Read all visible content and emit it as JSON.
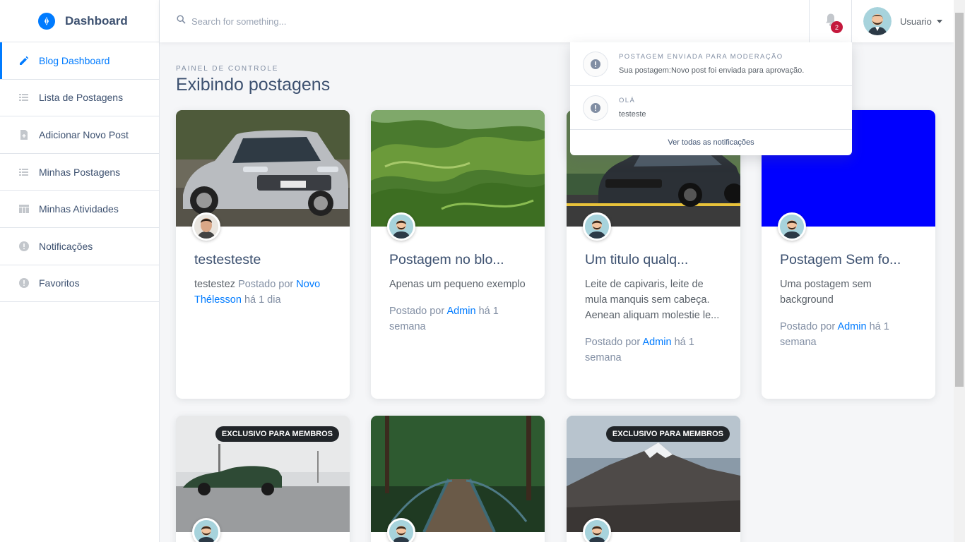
{
  "brand": {
    "title": "Dashboard"
  },
  "sidebar": {
    "items": [
      {
        "label": "Blog Dashboard",
        "icon": "edit-icon"
      },
      {
        "label": "Lista de Postagens",
        "icon": "list-icon"
      },
      {
        "label": "Adicionar Novo Post",
        "icon": "note-add-icon"
      },
      {
        "label": "Minhas Postagens",
        "icon": "list-icon"
      },
      {
        "label": "Minhas Atividades",
        "icon": "table-icon"
      },
      {
        "label": "Notificações",
        "icon": "info-icon"
      },
      {
        "label": "Favoritos",
        "icon": "info-icon"
      }
    ]
  },
  "topbar": {
    "search_placeholder": "Search for something...",
    "notification_count": "2",
    "user_name": "Usuario"
  },
  "page": {
    "subtitle": "PAINEL DE CONTROLE",
    "title": "Exibindo postagens"
  },
  "notifications": {
    "items": [
      {
        "title": "POSTAGEM ENVIADA PARA MODERAÇÃO",
        "text": "Sua postagem:Novo post foi enviada para aprovação."
      },
      {
        "title": "OLÁ",
        "text": "testeste"
      }
    ],
    "footer": "Ver todas as notificações"
  },
  "cards": [
    {
      "title": "testesteste",
      "excerpt": "testestez",
      "posted_by": "Postado por",
      "author": "Novo Thélesson",
      "time": "há 1 dia"
    },
    {
      "title": "Postagem no blo...",
      "excerpt": "Apenas um pequeno exemplo",
      "posted_by": "Postado por",
      "author": "Admin",
      "time": "há 1 semana"
    },
    {
      "title": "Um titulo qualq...",
      "excerpt": "Leite de capivaris, leite de mula manquis sem cabeça. Aenean aliquam molestie le...",
      "posted_by": "Postado por",
      "author": "Admin",
      "time": "há 1 semana"
    },
    {
      "title": "Postagem Sem fo...",
      "excerpt": "Uma postagem sem background",
      "posted_by": "Postado por",
      "author": "Admin",
      "time": "há 1 semana"
    },
    {
      "badge": "EXCLUSIVO PARA MEMBROS"
    },
    {},
    {
      "badge": "EXCLUSIVO PARA MEMBROS"
    }
  ]
}
